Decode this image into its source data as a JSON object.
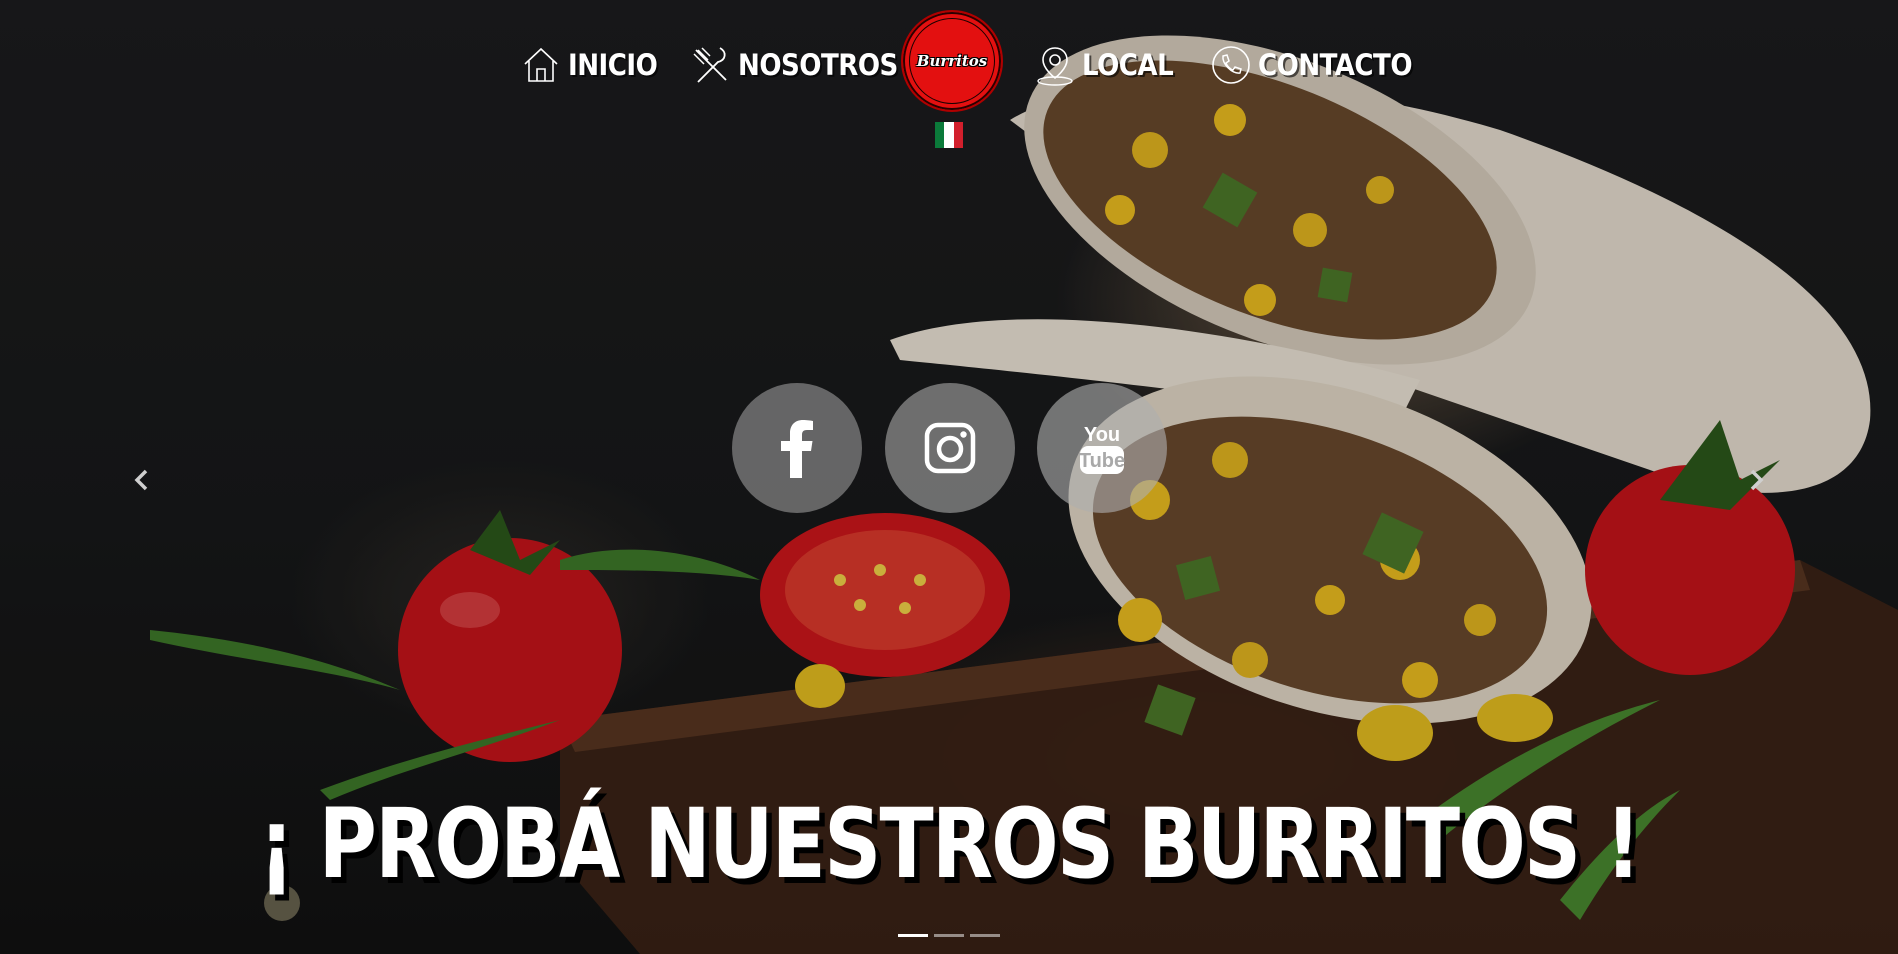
{
  "nav": {
    "items": [
      {
        "label": "INICIO",
        "icon": "home-icon"
      },
      {
        "label": "NOSOTROS",
        "icon": "fork-knife-icon"
      },
      {
        "label": "LOCAL",
        "icon": "location-pin-icon"
      },
      {
        "label": "CONTACTO",
        "icon": "phone-icon"
      }
    ],
    "logo": {
      "text": "Burritos",
      "color": "#e31010"
    },
    "language_flag": "mexico-flag"
  },
  "carousel": {
    "headline": "¡ PROBÁ NUESTROS BURRITOS !",
    "slide_count": 3,
    "active_slide": 1,
    "prev_icon": "chevron-left-icon",
    "next_icon": "chevron-right-icon"
  },
  "social": [
    {
      "name": "facebook",
      "icon": "facebook-icon"
    },
    {
      "name": "instagram",
      "icon": "instagram-icon"
    },
    {
      "name": "youtube",
      "icon": "youtube-icon",
      "text_top": "You",
      "text_bottom": "Tube"
    }
  ]
}
